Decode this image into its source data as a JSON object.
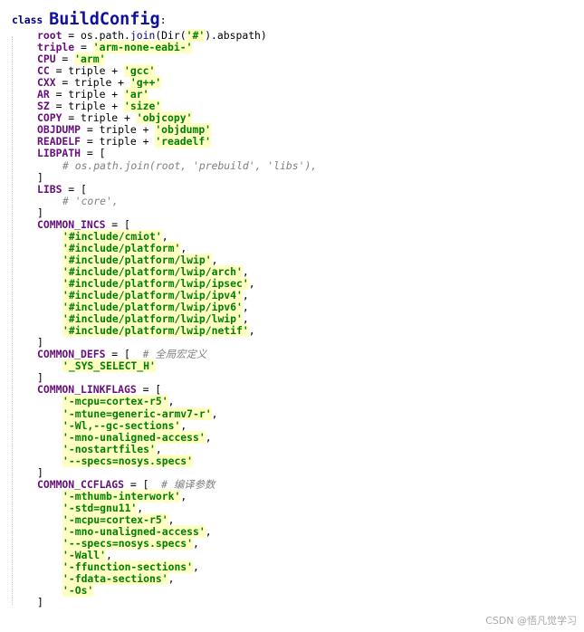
{
  "class_kw": "class",
  "class_name": "BuildConfig",
  "class_colon": ":",
  "lines": [
    {
      "ind": 1,
      "seg": [
        [
          "v",
          "root"
        ],
        [
          "p",
          " = os.path."
        ],
        [
          "f",
          "join"
        ],
        [
          "p",
          "(Dir("
        ],
        [
          "s",
          "'#'"
        ],
        [
          "p",
          ").abspath)"
        ]
      ]
    },
    {
      "ind": 1,
      "seg": [
        [
          "v",
          "triple"
        ],
        [
          "p",
          " = "
        ],
        [
          "s",
          "'arm-none-eabi-'"
        ]
      ]
    },
    {
      "ind": 1,
      "seg": [
        [
          "v",
          "CPU"
        ],
        [
          "p",
          " = "
        ],
        [
          "s",
          "'arm'"
        ]
      ]
    },
    {
      "ind": 1,
      "seg": [
        [
          "v",
          "CC"
        ],
        [
          "p",
          " = triple + "
        ],
        [
          "s",
          "'gcc'"
        ]
      ]
    },
    {
      "ind": 1,
      "seg": [
        [
          "v",
          "CXX"
        ],
        [
          "p",
          " = triple + "
        ],
        [
          "s",
          "'g++'"
        ]
      ]
    },
    {
      "ind": 1,
      "seg": [
        [
          "v",
          "AR"
        ],
        [
          "p",
          " = triple + "
        ],
        [
          "s",
          "'ar'"
        ]
      ]
    },
    {
      "ind": 1,
      "seg": [
        [
          "v",
          "SZ"
        ],
        [
          "p",
          " = triple + "
        ],
        [
          "s",
          "'size'"
        ]
      ]
    },
    {
      "ind": 1,
      "seg": [
        [
          "v",
          "COPY"
        ],
        [
          "p",
          " = triple + "
        ],
        [
          "s",
          "'objcopy'"
        ]
      ]
    },
    {
      "ind": 1,
      "seg": [
        [
          "v",
          "OBJDUMP"
        ],
        [
          "p",
          " = triple + "
        ],
        [
          "s",
          "'objdump'"
        ]
      ]
    },
    {
      "ind": 1,
      "seg": [
        [
          "v",
          "READELF"
        ],
        [
          "p",
          " = triple + "
        ],
        [
          "s",
          "'readelf'"
        ]
      ]
    },
    {
      "ind": 1,
      "seg": [
        [
          "v",
          "LIBPATH"
        ],
        [
          "p",
          " = ["
        ]
      ]
    },
    {
      "ind": 2,
      "seg": [
        [
          "c",
          "# os.path.join(root, 'prebuild', 'libs'),"
        ]
      ]
    },
    {
      "ind": 1,
      "seg": [
        [
          "p",
          "]"
        ]
      ]
    },
    {
      "ind": 1,
      "seg": [
        [
          "v",
          "LIBS"
        ],
        [
          "p",
          " = ["
        ]
      ]
    },
    {
      "ind": 2,
      "seg": [
        [
          "c",
          "# 'core',"
        ]
      ]
    },
    {
      "ind": 1,
      "seg": [
        [
          "p",
          "]"
        ]
      ]
    },
    {
      "ind": 1,
      "seg": [
        [
          "v",
          "COMMON_INCS"
        ],
        [
          "p",
          " = ["
        ]
      ]
    },
    {
      "ind": 2,
      "seg": [
        [
          "s",
          "'#include/cmiot'"
        ],
        [
          "p",
          ","
        ]
      ]
    },
    {
      "ind": 2,
      "seg": [
        [
          "s",
          "'#include/platform'"
        ],
        [
          "p",
          ","
        ]
      ]
    },
    {
      "ind": 2,
      "seg": [
        [
          "s",
          "'#include/platform/lwip'"
        ],
        [
          "p",
          ","
        ]
      ]
    },
    {
      "ind": 2,
      "seg": [
        [
          "s",
          "'#include/platform/lwip/arch'"
        ],
        [
          "p",
          ","
        ]
      ]
    },
    {
      "ind": 2,
      "seg": [
        [
          "s",
          "'#include/platform/lwip/ipsec'"
        ],
        [
          "p",
          ","
        ]
      ]
    },
    {
      "ind": 2,
      "seg": [
        [
          "s",
          "'#include/platform/lwip/ipv4'"
        ],
        [
          "p",
          ","
        ]
      ]
    },
    {
      "ind": 2,
      "seg": [
        [
          "s",
          "'#include/platform/lwip/ipv6'"
        ],
        [
          "p",
          ","
        ]
      ]
    },
    {
      "ind": 2,
      "seg": [
        [
          "s",
          "'#include/platform/lwip/lwip'"
        ],
        [
          "p",
          ","
        ]
      ]
    },
    {
      "ind": 2,
      "seg": [
        [
          "s",
          "'#include/platform/lwip/netif'"
        ],
        [
          "p",
          ","
        ]
      ]
    },
    {
      "ind": 1,
      "seg": [
        [
          "p",
          "]"
        ]
      ]
    },
    {
      "ind": 1,
      "seg": [
        [
          "v",
          "COMMON_DEFS"
        ],
        [
          "p",
          " = [  "
        ],
        [
          "c",
          "# 全局宏定义"
        ]
      ]
    },
    {
      "ind": 2,
      "seg": [
        [
          "s",
          "'_SYS_SELECT_H'"
        ]
      ]
    },
    {
      "ind": 1,
      "seg": [
        [
          "p",
          "]"
        ]
      ]
    },
    {
      "ind": 1,
      "seg": [
        [
          "v",
          "COMMON_LINKFLAGS"
        ],
        [
          "p",
          " = ["
        ]
      ]
    },
    {
      "ind": 2,
      "seg": [
        [
          "s",
          "'-mcpu=cortex-r5'"
        ],
        [
          "p",
          ","
        ]
      ]
    },
    {
      "ind": 2,
      "seg": [
        [
          "s",
          "'-mtune=generic-armv7-r'"
        ],
        [
          "p",
          ","
        ]
      ]
    },
    {
      "ind": 2,
      "seg": [
        [
          "s",
          "'-Wl,--gc-sections'"
        ],
        [
          "p",
          ","
        ]
      ]
    },
    {
      "ind": 2,
      "seg": [
        [
          "s",
          "'-mno-unaligned-access'"
        ],
        [
          "p",
          ","
        ]
      ]
    },
    {
      "ind": 2,
      "seg": [
        [
          "s",
          "'-nostartfiles'"
        ],
        [
          "p",
          ","
        ]
      ]
    },
    {
      "ind": 2,
      "seg": [
        [
          "s",
          "'--specs=nosys.specs'"
        ]
      ]
    },
    {
      "ind": 1,
      "seg": [
        [
          "p",
          "]"
        ]
      ]
    },
    {
      "ind": 1,
      "seg": [
        [
          "v",
          "COMMON_CCFLAGS"
        ],
        [
          "p",
          " = [  "
        ],
        [
          "c",
          "# 编译参数"
        ]
      ]
    },
    {
      "ind": 2,
      "seg": [
        [
          "s",
          "'-mthumb-interwork'"
        ],
        [
          "p",
          ","
        ]
      ]
    },
    {
      "ind": 2,
      "seg": [
        [
          "s",
          "'-std=gnu11'"
        ],
        [
          "p",
          ","
        ]
      ]
    },
    {
      "ind": 2,
      "seg": [
        [
          "s",
          "'-mcpu=cortex-r5'"
        ],
        [
          "p",
          ","
        ]
      ]
    },
    {
      "ind": 2,
      "seg": [
        [
          "s",
          "'-mno-unaligned-access'"
        ],
        [
          "p",
          ","
        ]
      ]
    },
    {
      "ind": 2,
      "seg": [
        [
          "s",
          "'--specs=nosys.specs'"
        ],
        [
          "p",
          ","
        ]
      ]
    },
    {
      "ind": 2,
      "seg": [
        [
          "s",
          "'-Wall'"
        ],
        [
          "p",
          ","
        ]
      ]
    },
    {
      "ind": 2,
      "seg": [
        [
          "s",
          "'-ffunction-sections'"
        ],
        [
          "p",
          ","
        ]
      ]
    },
    {
      "ind": 2,
      "seg": [
        [
          "s",
          "'-fdata-sections'"
        ],
        [
          "p",
          ","
        ]
      ]
    },
    {
      "ind": 2,
      "seg": [
        [
          "s",
          "'-Os'"
        ]
      ]
    },
    {
      "ind": 1,
      "seg": [
        [
          "p",
          "]"
        ]
      ]
    }
  ],
  "watermark": "CSDN @悟凡觉学习"
}
